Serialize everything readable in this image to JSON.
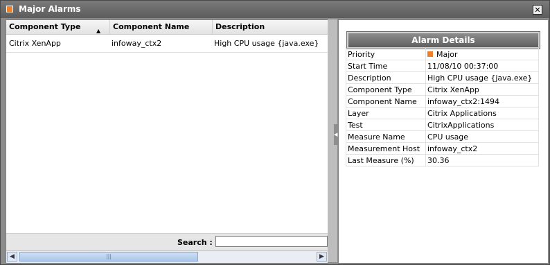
{
  "window": {
    "title": "Major Alarms",
    "close_symbol": "✕",
    "accent_color": "#f07f2a"
  },
  "grid": {
    "columns": [
      "Component Type",
      "Component Name",
      "Description"
    ],
    "sort_column": "Component Type",
    "sort_direction": "ascending",
    "rows": [
      {
        "type": "Citrix XenApp",
        "name": "infoway_ctx2",
        "description": "High CPU usage {java.exe}"
      }
    ]
  },
  "search": {
    "label": "Search :",
    "value": "",
    "placeholder": ""
  },
  "details": {
    "title": "Alarm Details",
    "fields": [
      {
        "label": "Priority",
        "value": "Major"
      },
      {
        "label": "Start Time",
        "value": "11/08/10 00:37:00"
      },
      {
        "label": "Description",
        "value": "High CPU usage {java.exe}"
      },
      {
        "label": "Component Type",
        "value": "Citrix XenApp"
      },
      {
        "label": "Component Name",
        "value": "infoway_ctx2:1494"
      },
      {
        "label": "Layer",
        "value": "Citrix Applications"
      },
      {
        "label": "Test",
        "value": "CitrixApplications"
      },
      {
        "label": "Measure Name",
        "value": "CPU usage"
      },
      {
        "label": "Measurement Host",
        "value": "infoway_ctx2"
      },
      {
        "label": "Last Measure (%)",
        "value": "30.36"
      }
    ]
  }
}
